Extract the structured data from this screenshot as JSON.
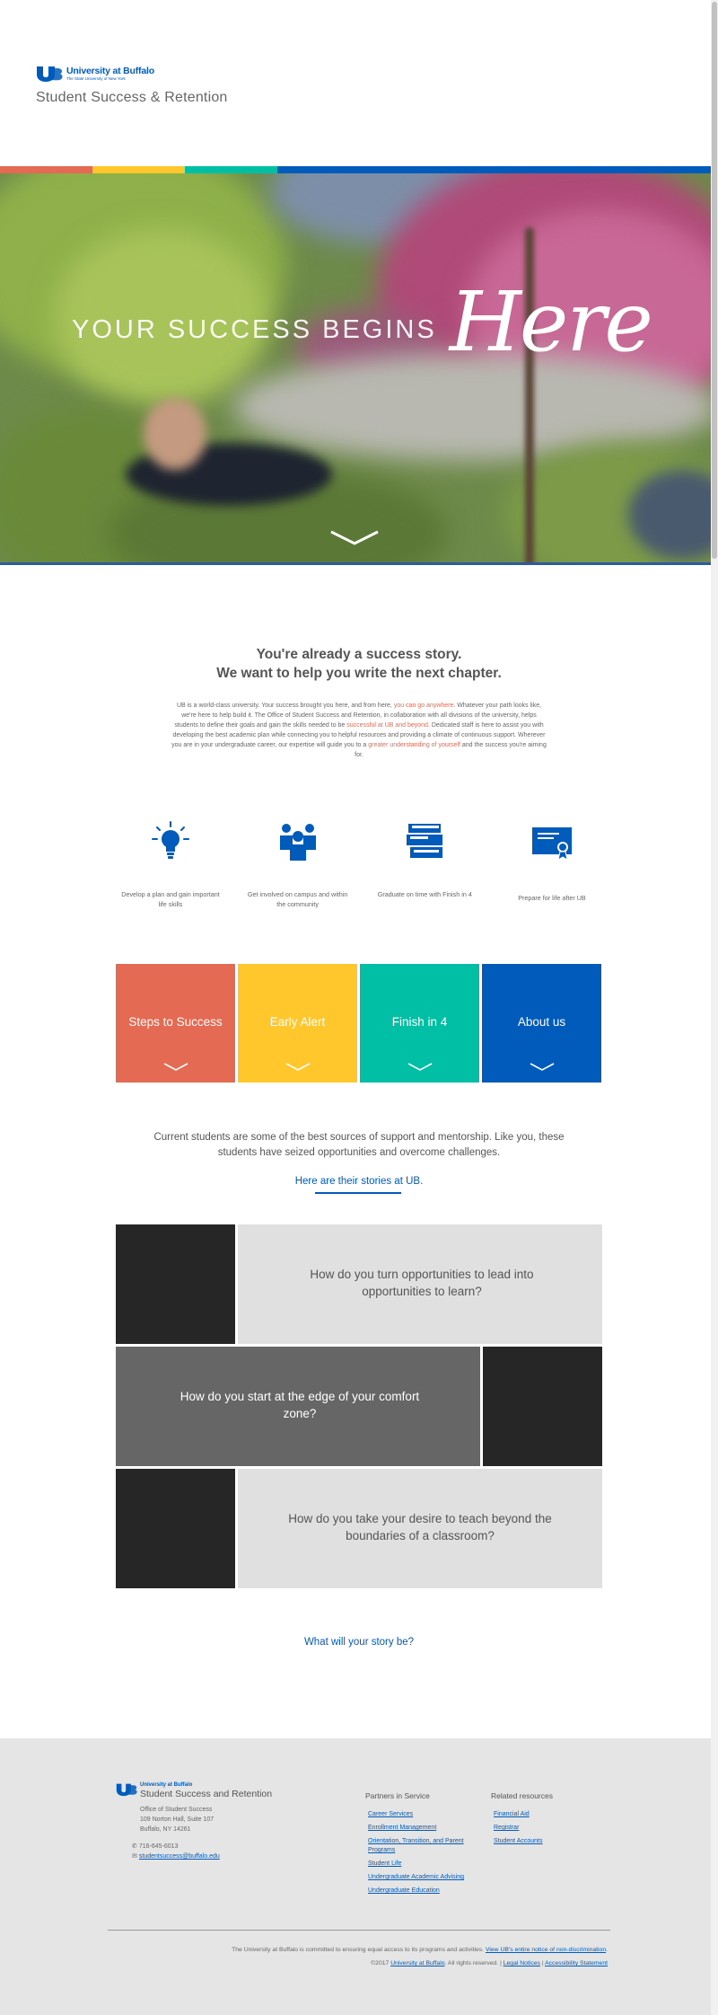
{
  "header": {
    "logo_title": "University at Buffalo",
    "logo_subtitle": "The State University of New York",
    "site_title": "Student Success & Retention"
  },
  "colors": {
    "strip": [
      "#e56a54",
      "#ffc72c",
      "#00bfa5",
      "#005bbb"
    ],
    "ub_blue": "#005bbb"
  },
  "hero": {
    "headline_small": "YOUR SUCCESS BEGINS",
    "headline_script": "Here",
    "scroll_icon": "chevron-down-icon"
  },
  "intro": {
    "heading_line1": "You're already a success story.",
    "heading_line2": "We want to help you write the next chapter.",
    "body_1": "UB is a world-class university. Your success brought you here, and from here, ",
    "link_1": "you can go anywhere",
    "body_2": ". Whatever your path looks like, we're here to help build it. The Office of Student Success and Retention, in collaboration with all divisions of the university, helps students to define their goals and gain the skills needed to be ",
    "link_2": "successful at UB and beyond",
    "body_3": ". Dedicated staff is here to assist you with developing the best academic plan while connecting you to helpful resources and providing a climate of continuous support. Wherever you are in your undergraduate career, our expertise will guide you to a ",
    "link_3": "greater understanding of yourself",
    "body_4": " and the success you're aiming for."
  },
  "features": [
    {
      "icon": "lightbulb-icon",
      "caption": "Develop a plan and gain important life skills"
    },
    {
      "icon": "people-icon",
      "caption": "Get involved on campus and within the community"
    },
    {
      "icon": "books-icon",
      "caption": "Graduate on time with Finish in 4"
    },
    {
      "icon": "diploma-icon",
      "caption": "Prepare for life after UB"
    }
  ],
  "tiles": [
    {
      "label": "Steps to Success",
      "color": "#e56a54"
    },
    {
      "label": "Early Alert",
      "color": "#ffc72c"
    },
    {
      "label": "Finish in 4",
      "color": "#00bfa5"
    },
    {
      "label": "About us",
      "color": "#005bbb"
    }
  ],
  "stories": {
    "intro": "Current students are some of the best sources of support and mentorship. Like you, these students have seized opportunities and overcome challenges.",
    "link": "Here are their stories at UB.",
    "q1": "How do you turn opportunities to lead into opportunities to learn?",
    "q2": "How do you start at the edge of your comfort zone?",
    "q3": "How do you take your desire to teach beyond the boundaries of a classroom?",
    "cta": "What will your story be?"
  },
  "footer": {
    "logo_small": "University at Buffalo",
    "logo_big": "Student Success and Retention",
    "office": "Office of Student Success",
    "address1": "109 Norton Hall, Suite 107",
    "address2": "Buffalo, NY 14261",
    "phone": "716-645-6013",
    "email": "studentsuccess@buffalo.edu",
    "partners_heading": "Partners in Service",
    "partners": [
      "Career Services",
      "Enrollment Management",
      "Orientation, Transition, and Parent Programs",
      "Student Life",
      "Undergraduate Academic Advising",
      "Undergraduate Education"
    ],
    "related_heading": "Related resources",
    "related": [
      "Financial Aid",
      "Registrar",
      "Student Accounts"
    ],
    "legal_text": "The University at Buffalo is committed to ensuring equal access to its programs and activities.",
    "legal_link": "View UB's entire notice of non-discrimination",
    "copyright": "©2017",
    "copyright_link": "University at Buffalo",
    "rights": ". All rights reserved.",
    "legal_notices": "Legal Notices",
    "accessibility": "Accessibility Statement"
  }
}
